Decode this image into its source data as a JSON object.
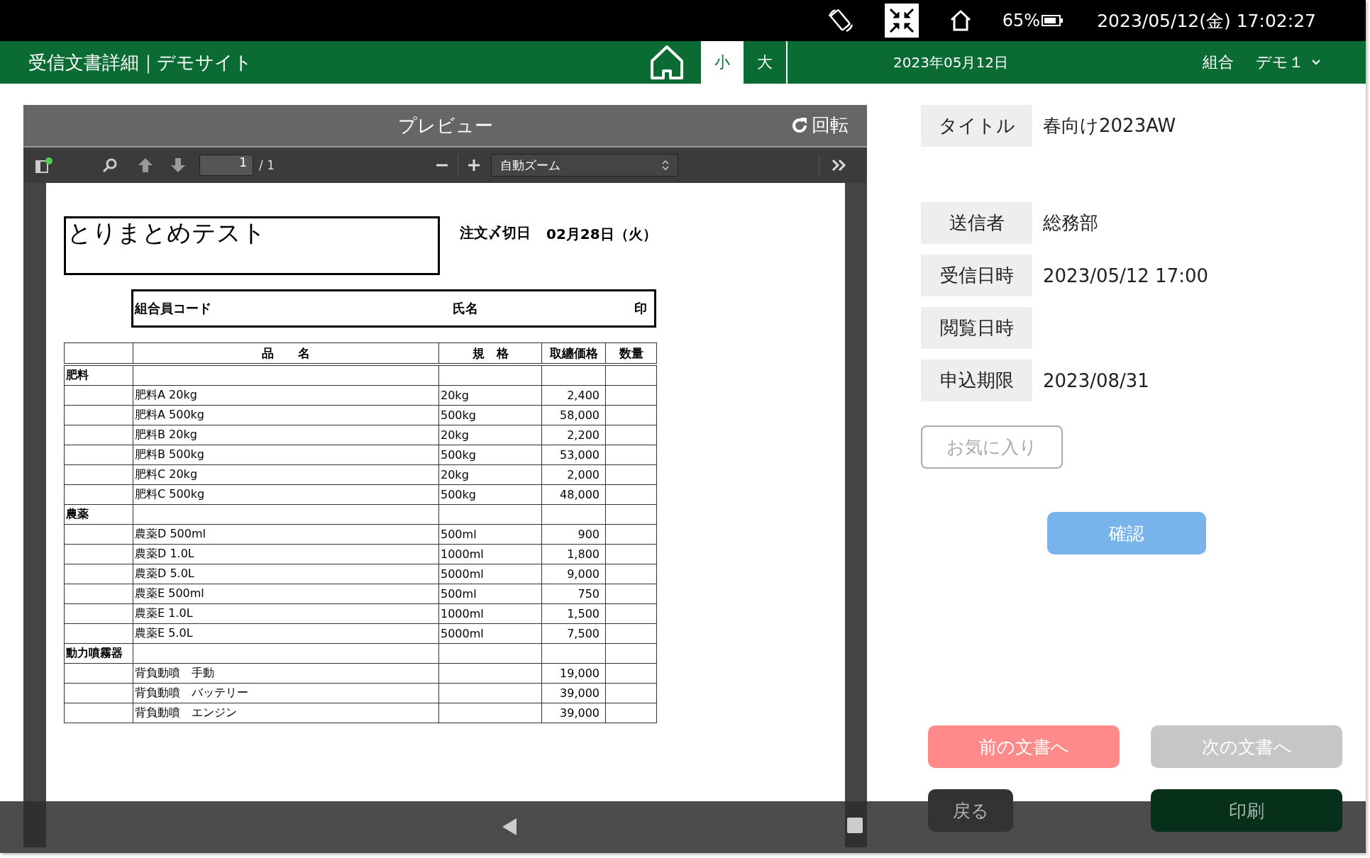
{
  "status_bar": {
    "battery": "65%",
    "datetime": "2023/05/12(金) 17:02:27"
  },
  "header": {
    "title": "受信文書詳細｜デモサイト",
    "size_tabs": [
      {
        "label": "小",
        "selected": true
      },
      {
        "label": "大",
        "selected": false
      }
    ],
    "date": "2023年05月12日",
    "group": "組合",
    "user": "デモ１"
  },
  "preview": {
    "title": "プレビュー",
    "rotate": "回転",
    "toolbar": {
      "page": "1",
      "page_total": "/ 1",
      "zoom": "自動ズーム"
    },
    "document": {
      "title": "とりまとめテスト",
      "deadline_label": "注文〆切日",
      "deadline": "02月28日（火）",
      "member_code_label": "組合員コード",
      "name_label": "氏名",
      "seal_label": "印",
      "table": {
        "columns": [
          "品　　名",
          "規　格",
          "取纏価格",
          "数量"
        ],
        "rows": [
          {
            "kind": "category",
            "name": "肥料"
          },
          {
            "kind": "item",
            "name": "肥料A 20kg",
            "spec": "20kg",
            "price": "2,400"
          },
          {
            "kind": "item",
            "name": "肥料A 500kg",
            "spec": "500kg",
            "price": "58,000"
          },
          {
            "kind": "item",
            "name": "肥料B 20kg",
            "spec": "20kg",
            "price": "2,200"
          },
          {
            "kind": "item",
            "name": "肥料B 500kg",
            "spec": "500kg",
            "price": "53,000"
          },
          {
            "kind": "item",
            "name": "肥料C 20kg",
            "spec": "20kg",
            "price": "2,000"
          },
          {
            "kind": "item",
            "name": "肥料C 500kg",
            "spec": "500kg",
            "price": "48,000"
          },
          {
            "kind": "category",
            "name": "農薬"
          },
          {
            "kind": "item",
            "name": "農薬D 500ml",
            "spec": "500ml",
            "price": "900"
          },
          {
            "kind": "item",
            "name": "農薬D 1.0L",
            "spec": "1000ml",
            "price": "1,800"
          },
          {
            "kind": "item",
            "name": "農薬D 5.0L",
            "spec": "5000ml",
            "price": "9,000"
          },
          {
            "kind": "item",
            "name": "農薬E 500ml",
            "spec": "500ml",
            "price": "750"
          },
          {
            "kind": "item",
            "name": "農薬E 1.0L",
            "spec": "1000ml",
            "price": "1,500"
          },
          {
            "kind": "item",
            "name": "農薬E 5.0L",
            "spec": "5000ml",
            "price": "7,500"
          },
          {
            "kind": "category",
            "name": "動力噴霧器"
          },
          {
            "kind": "item",
            "name": "背負動噴　手動",
            "price": "19,000"
          },
          {
            "kind": "item",
            "name": "背負動噴　バッテリー",
            "price": "39,000"
          },
          {
            "kind": "item",
            "name": "背負動噴　エンジン",
            "price": "39,000"
          }
        ]
      }
    }
  },
  "details": [
    {
      "label": "タイトル",
      "value": "春向け2023AW"
    },
    {
      "label": "送信者",
      "value": "総務部"
    },
    {
      "label": "受信日時",
      "value": "2023/05/12 17:00"
    },
    {
      "label": "閲覧日時"
    },
    {
      "label": "申込期限",
      "value": "2023/08/31"
    }
  ],
  "favorite_button": "お気に入り",
  "confirm_button": "確認",
  "buttons": [
    {
      "label": "前の文書へ",
      "kind": "prev",
      "disabled": false
    },
    {
      "label": "次の文書へ",
      "kind": "next",
      "disabled": true
    },
    {
      "label": "戻る",
      "kind": "back",
      "disabled": false
    },
    {
      "label": "印刷",
      "kind": "print",
      "disabled": false
    }
  ]
}
